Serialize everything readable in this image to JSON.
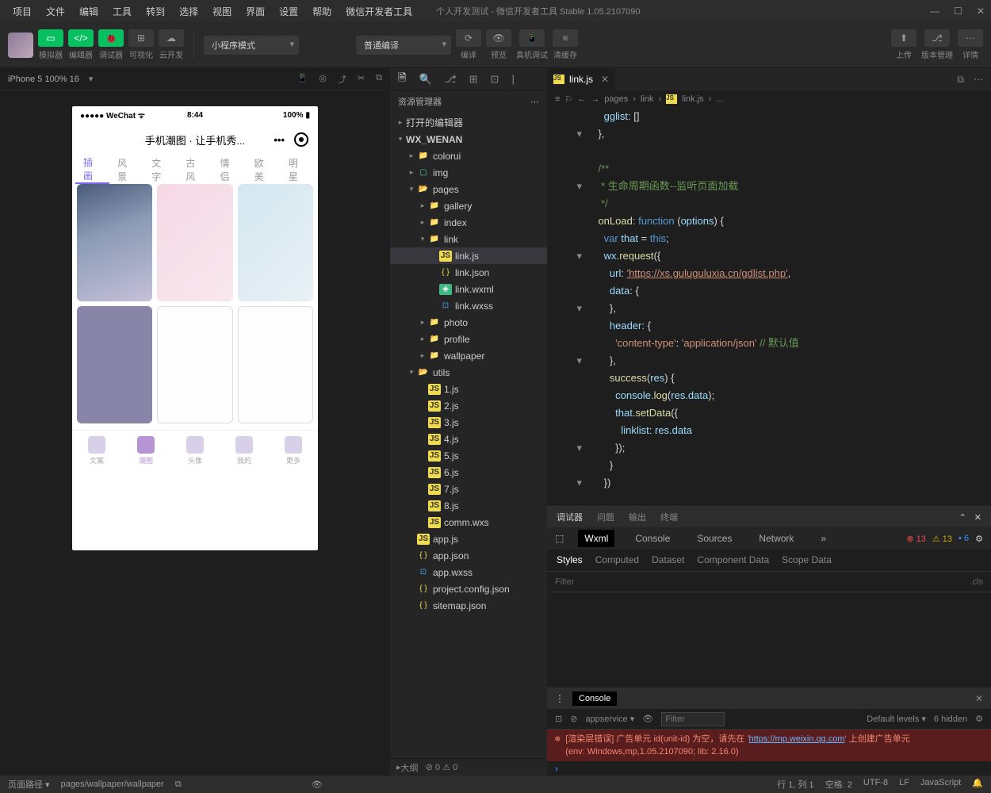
{
  "menubar": {
    "items": [
      "项目",
      "文件",
      "编辑",
      "工具",
      "转到",
      "选择",
      "视图",
      "界面",
      "设置",
      "帮助",
      "微信开发者工具"
    ],
    "title": "个人开发测试 - 微信开发者工具 Stable 1.05.2107090"
  },
  "toolbar": {
    "groups": [
      {
        "label": "模拟器",
        "icon": "▭"
      },
      {
        "label": "编辑器",
        "icon": "</>"
      },
      {
        "label": "调试器",
        "icon": "⚙"
      },
      {
        "label": "可视化",
        "icon": "⊞"
      },
      {
        "label": "云开发",
        "icon": "☁"
      }
    ],
    "mode": "小程序模式",
    "compile": "普通编译",
    "actions": [
      {
        "label": "编译",
        "icon": "⟳"
      },
      {
        "label": "预览",
        "icon": "👁"
      },
      {
        "label": "真机调试",
        "icon": "📱"
      },
      {
        "label": "清缓存",
        "icon": "🗑"
      }
    ],
    "right": [
      {
        "label": "上传",
        "icon": "⬆"
      },
      {
        "label": "版本管理",
        "icon": "⎇"
      },
      {
        "label": "详情",
        "icon": "⋯"
      }
    ]
  },
  "simulator": {
    "device": "iPhone 5 100% 16",
    "wechat_label": "WeChat",
    "time": "8:44",
    "battery": "100%",
    "title": "手机潮图 · 让手机秀...",
    "tabs": [
      "插画",
      "风景",
      "文字",
      "古风",
      "情侣",
      "欧美",
      "明星"
    ],
    "tabbar": [
      "文案",
      "潮图",
      "头像",
      "我的",
      "更多"
    ]
  },
  "explorer": {
    "title": "资源管理器",
    "sections": [
      "打开的编辑器",
      "WX_WENAN"
    ],
    "tree": {
      "colorui": "colorui",
      "img": "img",
      "pages": "pages",
      "gallery": "gallery",
      "index": "index",
      "link": "link",
      "linkjs": "link.js",
      "linkjson": "link.json",
      "linkwxml": "link.wxml",
      "linkwxss": "link.wxss",
      "photo": "photo",
      "profile": "profile",
      "wallpaper": "wallpaper",
      "utils": "utils",
      "u1": "1.js",
      "u2": "2.js",
      "u3": "3.js",
      "u4": "4.js",
      "u5": "5.js",
      "u6": "6.js",
      "u7": "7.js",
      "u8": "8.js",
      "commwxs": "comm.wxs",
      "appjs": "app.js",
      "appjson": "app.json",
      "appwxss": "app.wxss",
      "project": "project.config.json",
      "sitemap": "sitemap.json"
    },
    "outline": "大纲"
  },
  "editor": {
    "tab": "link.js",
    "breadcrumb": [
      "pages",
      "link",
      "link.js",
      "..."
    ],
    "code": {
      "gglist": "gglist",
      "onLoad": "onLoad",
      "function": "function",
      "options": "options",
      "var": "var",
      "that": "that",
      "this": "this",
      "wx": "wx",
      "request": "request",
      "url_label": "url",
      "url": "'https://xs.guluguluxia.cn/gdlist.php'",
      "data_label": "data",
      "header_label": "header",
      "ct_key": "'content-type'",
      "ct_val": "'application/json'",
      "ct_com": "// 默认值",
      "success": "success",
      "res": "res",
      "console": "console",
      "log": "log",
      "resdata": "res.data",
      "setData": "setData",
      "linklist": "linklist",
      "com1": "/**",
      "com2": " * 生命周期函数--监听页面加载",
      "com3": " */"
    }
  },
  "debug": {
    "tabs": [
      "调试器",
      "问题",
      "输出",
      "终端"
    ],
    "subtabs": [
      "Wxml",
      "Console",
      "Sources",
      "Network"
    ],
    "badges": {
      "err": "13",
      "warn": "13",
      "info": "6"
    },
    "styles_tabs": [
      "Styles",
      "Computed",
      "Dataset",
      "Component Data",
      "Scope Data"
    ],
    "filter": "Filter",
    "cls": ".cls"
  },
  "console": {
    "head": "Console",
    "appservice": "appservice",
    "filter_ph": "Filter",
    "levels": "Default levels",
    "hidden": "6 hidden",
    "err1": "[渲染层错误] 广告单元 id(unit-id) 为空，请先在 '",
    "err_url": "https://mp.weixin.qq.com",
    "err1b": "' 上创建广告单元",
    "err2": "(env: Windows,mp,1.05.2107090; lib: 2.16.0)"
  },
  "status": {
    "pathlabel": "页面路径",
    "path": "pages/wallpaper/wallpaper",
    "counts": "0 ⚠ 0",
    "line": "行 1, 列 1",
    "spaces": "空格: 2",
    "enc": "UTF-8",
    "eol": "LF",
    "lang": "JavaScript"
  }
}
